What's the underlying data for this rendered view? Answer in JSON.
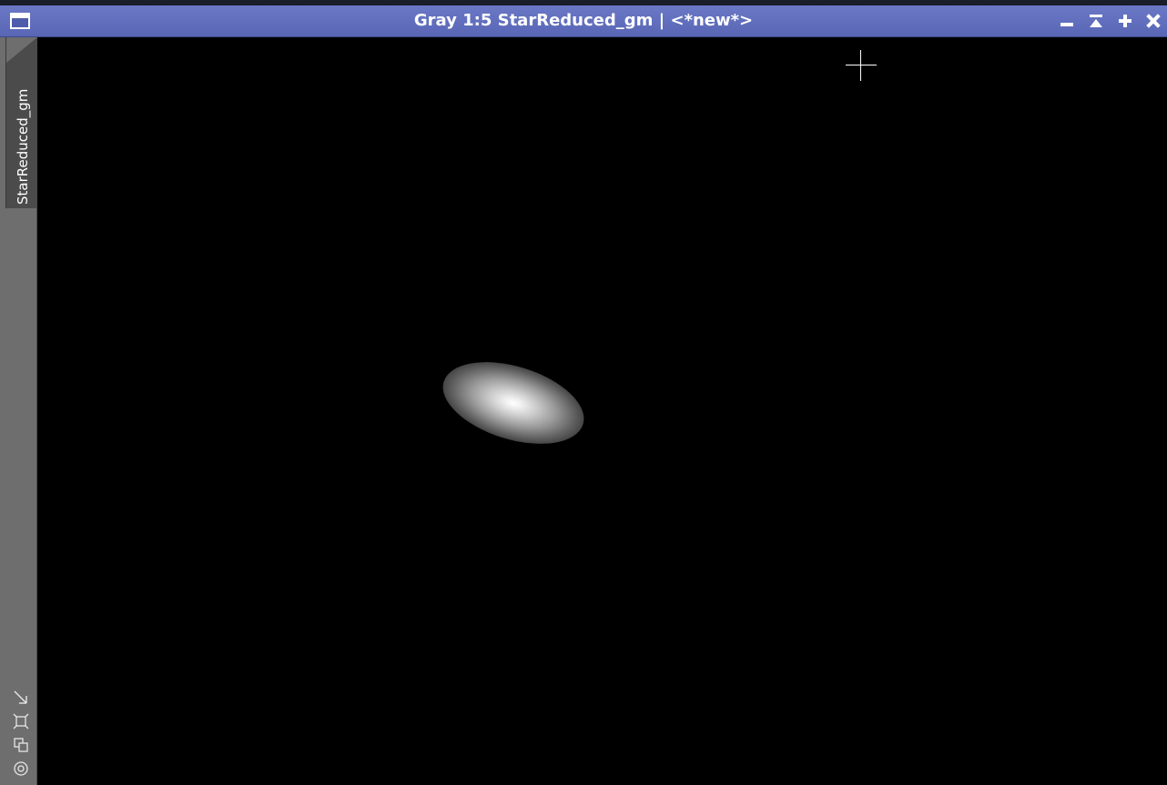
{
  "window": {
    "title": "Gray 1:5 StarReduced_gm | <*new*>",
    "titlebar_color": "#5866b5"
  },
  "title_buttons": {
    "window_menu_icon": "window-menu-icon",
    "minimize_icon": "minimize-icon",
    "shade_icon": "shade-icon",
    "maximize_icon": "maximize-icon",
    "close_icon": "close-icon"
  },
  "sidebar": {
    "view_tab_label": "StarReduced_gm",
    "tools": [
      {
        "icon": "resize-icon"
      },
      {
        "icon": "fit-view-icon"
      },
      {
        "icon": "clone-icon"
      },
      {
        "icon": "target-icon"
      }
    ]
  },
  "canvas": {
    "background": "#000000",
    "object": "galaxy-image",
    "cursor": "crosshair-cursor"
  }
}
